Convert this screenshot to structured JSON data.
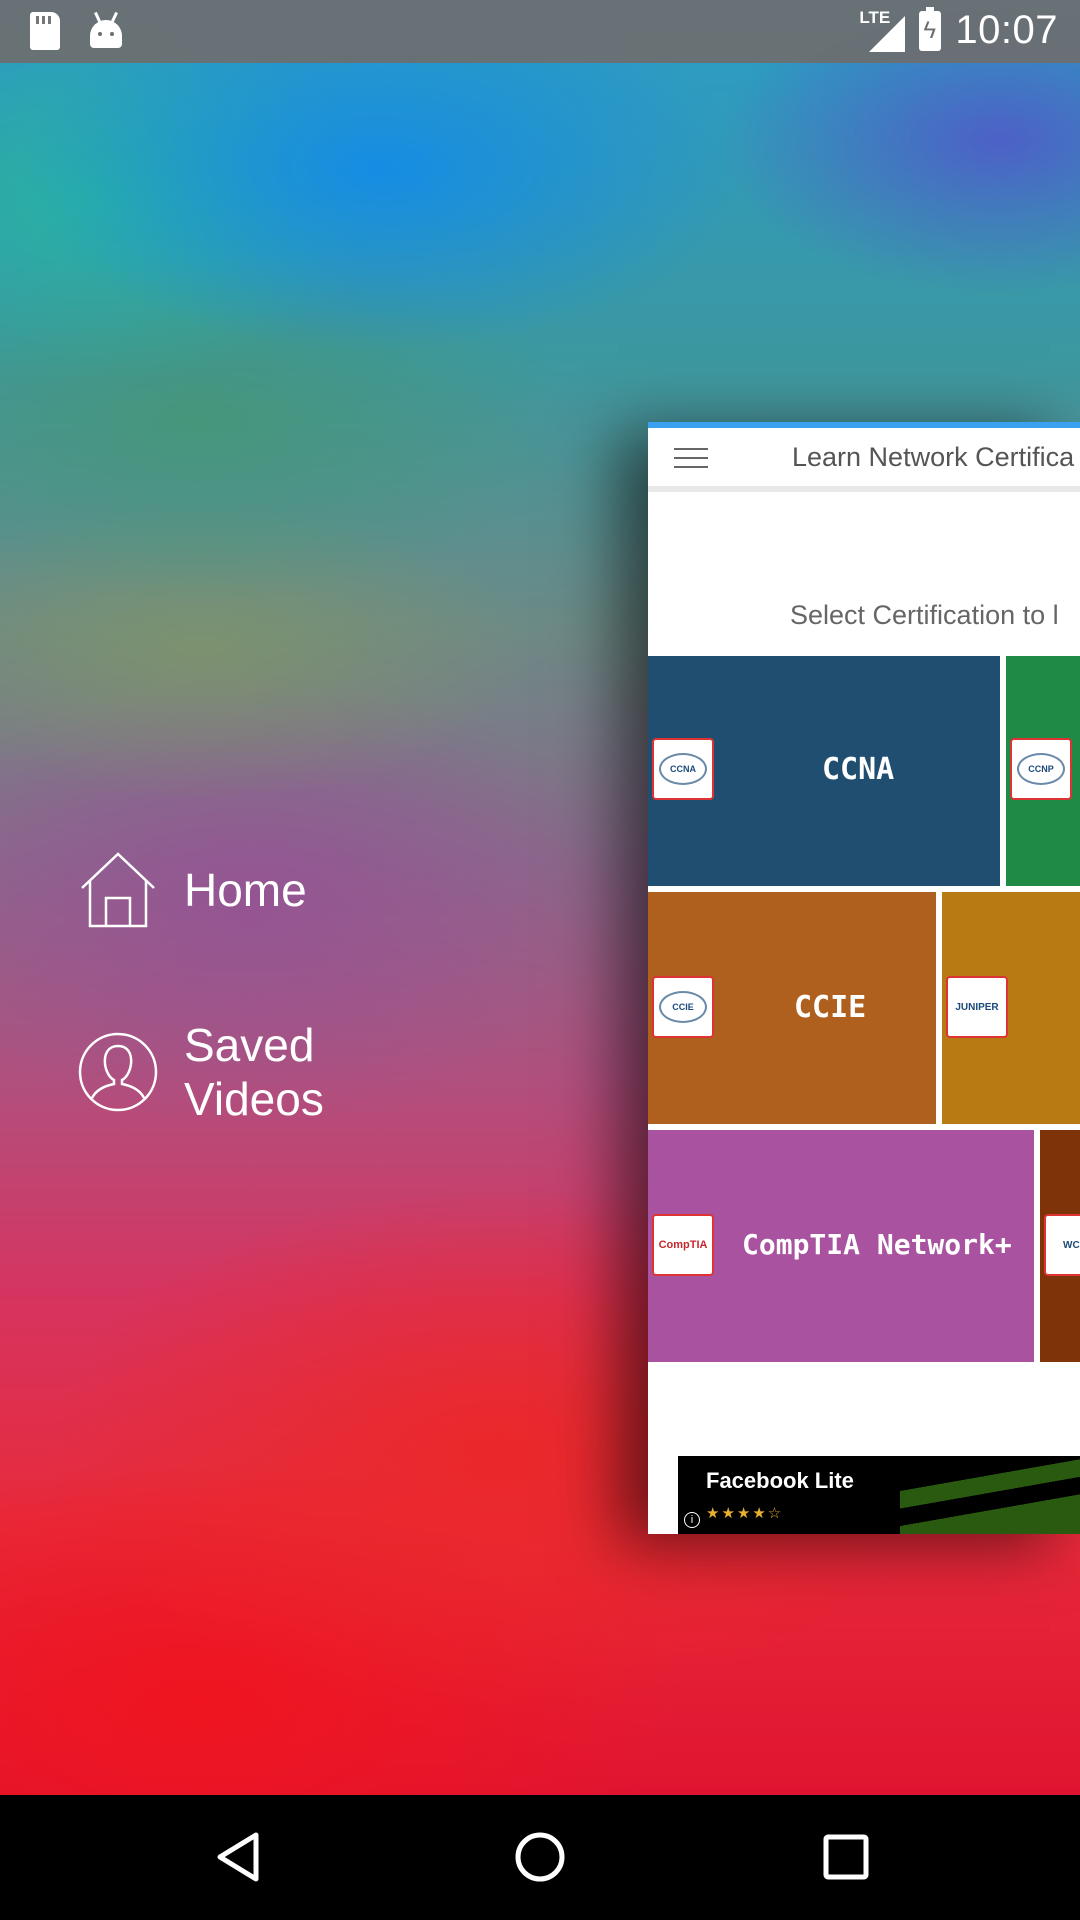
{
  "status_bar": {
    "time": "10:07",
    "network": "LTE",
    "icons": [
      "sd-card-icon",
      "android-debug-icon",
      "lte-signal-icon",
      "battery-charging-icon"
    ]
  },
  "drawer": {
    "items": [
      {
        "label": "Home",
        "icon": "home-icon"
      },
      {
        "label": "Saved Videos",
        "icon": "user-icon"
      }
    ]
  },
  "app": {
    "title": "Learn Network Certifica",
    "subtitle": "Select  Certification to l",
    "accent": "#3aa0f0",
    "tiles": [
      {
        "label": "CCNA",
        "badge": "CCNA",
        "color": "#1f4e70"
      },
      {
        "label": "",
        "badge": "CCNP",
        "color": "#1f8a45"
      },
      {
        "label": "CCIE",
        "badge": "CCIE",
        "color": "#b0601e"
      },
      {
        "label": "",
        "badge": "JUNIPER",
        "color": "#b87a12"
      },
      {
        "label": "CompTIA Network+",
        "badge": "CompTIA",
        "color": "#a852a0"
      },
      {
        "label": "",
        "badge": "WCN",
        "color": "#7e3408"
      }
    ],
    "ad": {
      "title": "Facebook Lite",
      "stars": "★★★★☆",
      "rating": 4.5,
      "info": "i"
    }
  },
  "nav_bar": {
    "buttons": [
      "back-icon",
      "home-circle-icon",
      "recents-icon"
    ]
  }
}
